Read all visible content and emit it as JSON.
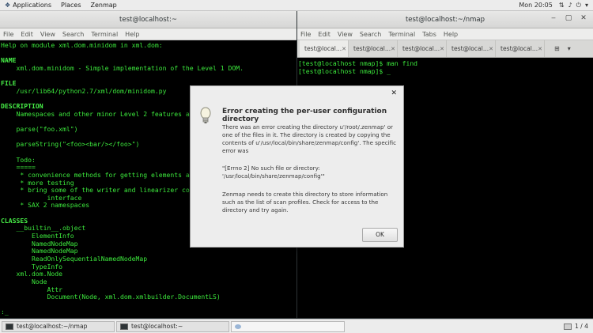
{
  "topbar": {
    "applications": "Applications",
    "places": "Places",
    "zenmap": "Zenmap",
    "clock": "Mon 20:05"
  },
  "left_terminal": {
    "title": "test@localhost:~",
    "menu": [
      "File",
      "Edit",
      "View",
      "Search",
      "Terminal",
      "Help"
    ],
    "lines": [
      "Help on module xml.dom.minidom in xml.dom:",
      "",
      "NAME",
      "    xml.dom.minidom - Simple implementation of the Level 1 DOM.",
      "",
      "FILE",
      "    /usr/lib64/python2.7/xml/dom/minidom.py",
      "",
      "DESCRIPTION",
      "    Namespaces and other minor Level 2 features are also supported.",
      "",
      "    parse(\"foo.xml\")",
      "",
      "    parseString(\"<foo><bar/></foo>\")",
      "",
      "    Todo:",
      "    =====",
      "     * convenience methods for getting elements and text.",
      "     * more testing",
      "     * bring some of the writer and linearizer code into conformance with this",
      "            interface",
      "     * SAX 2 namespaces",
      "",
      "CLASSES",
      "    __builtin__.object",
      "        ElementInfo",
      "        NamedNodeMap",
      "        NamedNodeMap",
      "        ReadOnlySequentialNamedNodeMap",
      "        TypeInfo",
      "    xml.dom.Node",
      "        Node",
      "            Attr",
      "            Document(Node, xml.dom.xmlbuilder.DocumentLS)",
      "",
      ":_"
    ]
  },
  "right_terminal": {
    "title": "test@localhost:~/nmap",
    "menu": [
      "File",
      "Edit",
      "View",
      "Search",
      "Terminal",
      "Tabs",
      "Help"
    ],
    "tabs": [
      "test@local...",
      "test@local...",
      "test@local...",
      "test@local...",
      "test@local..."
    ],
    "lines": [
      "[test@localhost nmap]$ man find",
      "[test@localhost nmap]$ _"
    ]
  },
  "dialog": {
    "title": "Error creating the per-user configuration directory",
    "paragraph1": "There was an error creating the directory u'/root/.zenmap' or one of the files in it. The directory is created by copying the contents of u'/usr/local/bin/share/zenmap/config'. The specific error was",
    "paragraph2": "\"[Errno 2] No such file or directory: '/usr/local/bin/share/zenmap/config'\"",
    "paragraph3": "Zenmap needs to create this directory to store information such as the list of scan profiles. Check for access to the directory and try again.",
    "ok_label": "OK"
  },
  "taskbar": {
    "task1": "test@localhost:~/nmap",
    "task2": "test@localhost:~",
    "workspace": "1 / 4"
  }
}
